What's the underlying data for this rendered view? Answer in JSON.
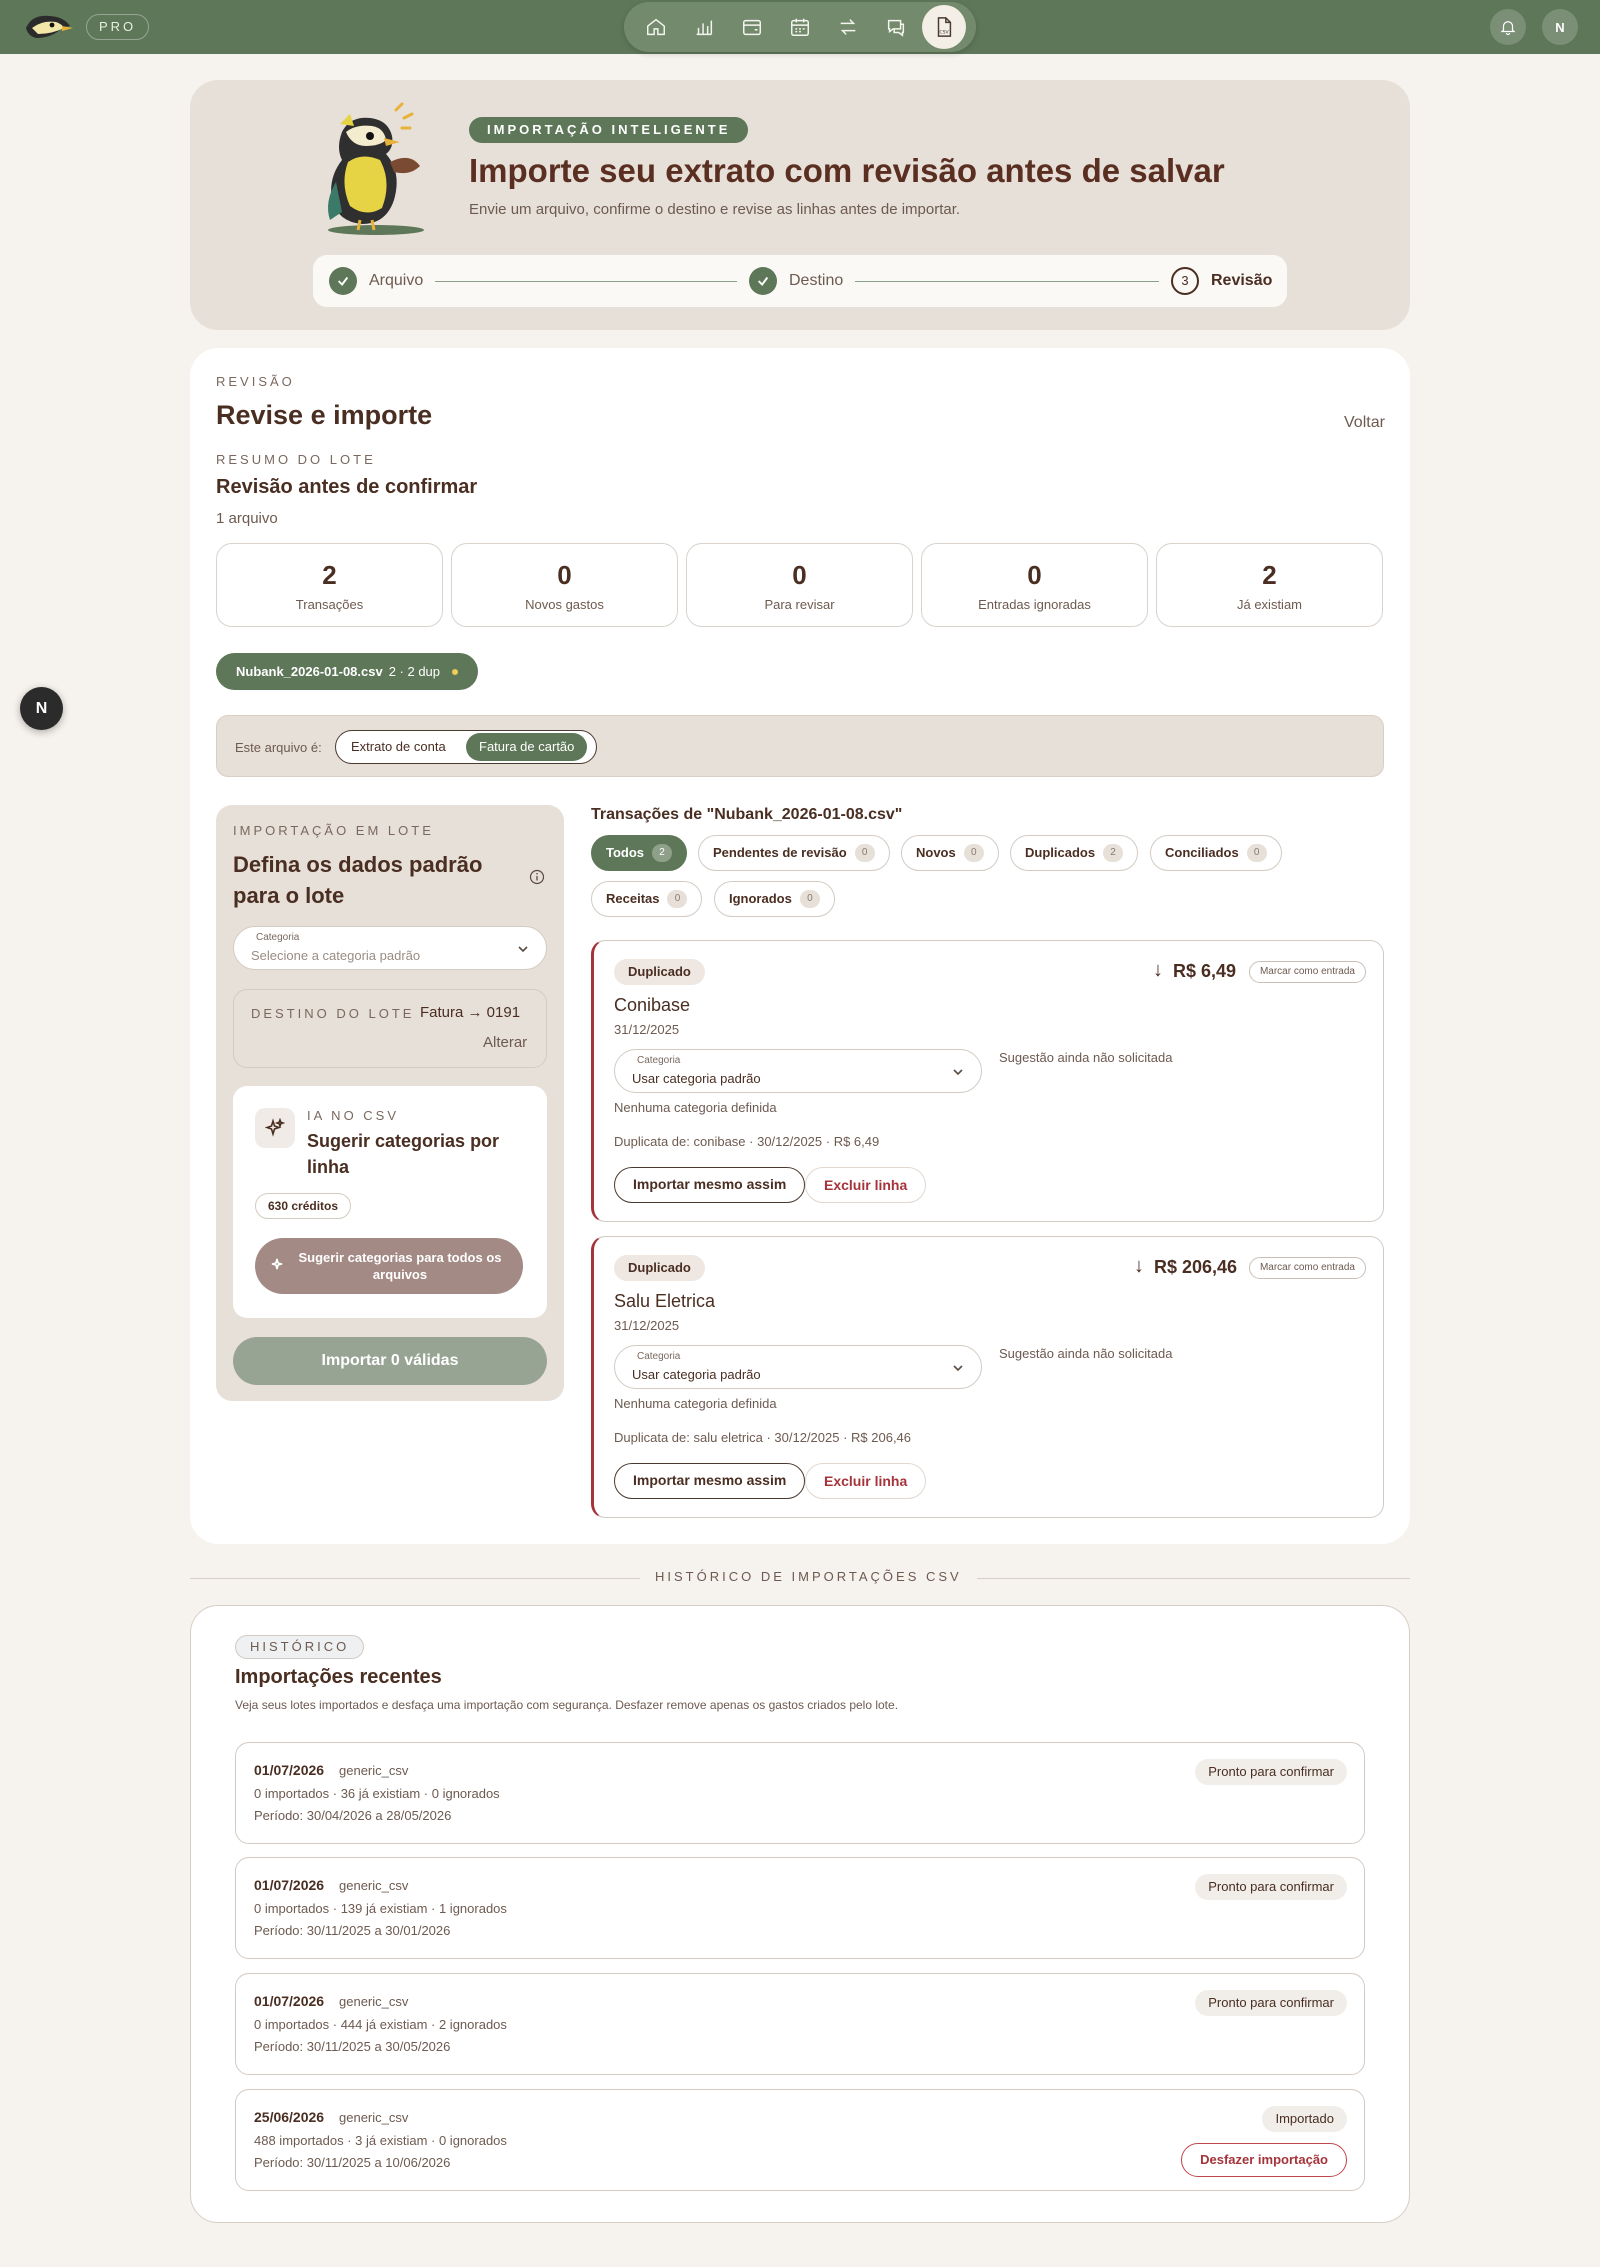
{
  "topbar": {
    "plan_badge": "PRO",
    "notification_icon": "bell-icon",
    "user_initial": "N",
    "nav": [
      {
        "id": "home",
        "icon": "home-icon"
      },
      {
        "id": "reports",
        "icon": "bar-chart-icon"
      },
      {
        "id": "wallet",
        "icon": "wallet-icon"
      },
      {
        "id": "calendar",
        "icon": "calendar-icon"
      },
      {
        "id": "transfers",
        "icon": "swap-icon"
      },
      {
        "id": "chat",
        "icon": "chat-icon"
      },
      {
        "id": "csv",
        "icon": "csv-file-icon",
        "glyph": "CSV",
        "active": true
      }
    ]
  },
  "hero": {
    "tag": "IMPORTAÇÃO INTELIGENTE",
    "title": "Importe seu extrato com revisão antes de salvar",
    "subtitle": "Envie um arquivo, confirme o destino e revise as linhas antes de importar.",
    "steps": [
      {
        "label": "Arquivo",
        "state": "done"
      },
      {
        "label": "Destino",
        "state": "done"
      },
      {
        "label": "Revisão",
        "state": "current",
        "number": "3"
      }
    ]
  },
  "review": {
    "eyebrow": "REVISÃO",
    "title": "Revise e importe",
    "back_label": "Voltar",
    "summary_eyebrow": "RESUMO DO LOTE",
    "summary_title": "Revisão antes de confirmar",
    "file_count": "1 arquivo",
    "stats": [
      {
        "value": "2",
        "label": "Transações"
      },
      {
        "value": "0",
        "label": "Novos gastos"
      },
      {
        "value": "0",
        "label": "Para revisar"
      },
      {
        "value": "0",
        "label": "Entradas ignoradas"
      },
      {
        "value": "2",
        "label": "Já existiam"
      }
    ],
    "file_chip": {
      "name": "Nubank_2026-01-08.csv",
      "meta": "2 · 2 dup"
    },
    "file_type": {
      "label": "Este arquivo é:",
      "options": [
        "Extrato de conta",
        "Fatura de cartão"
      ],
      "selected": "Fatura de cartão"
    }
  },
  "batch": {
    "eyebrow": "IMPORTAÇÃO EM LOTE",
    "title": "Defina os dados padrão para o lote",
    "category_caption": "Categoria",
    "category_placeholder": "Selecione a categoria padrão",
    "destination_eyebrow": "DESTINO DO LOTE",
    "destination_value": "Fatura → 0191",
    "change_label": "Alterar",
    "ai": {
      "eyebrow": "IA NO CSV",
      "title": "Sugerir categorias por linha",
      "credits": "630 créditos",
      "button_label": "Sugerir categorias para todos os arquivos"
    },
    "import_button": "Importar 0 válidas"
  },
  "transactions": {
    "title": "Transações de \"Nubank_2026-01-08.csv\"",
    "filters": [
      {
        "label": "Todos",
        "count": "2",
        "active": true
      },
      {
        "label": "Pendentes de revisão",
        "count": "0"
      },
      {
        "label": "Novos",
        "count": "0"
      },
      {
        "label": "Duplicados",
        "count": "2"
      },
      {
        "label": "Conciliados",
        "count": "0"
      },
      {
        "label": "Receitas",
        "count": "0"
      },
      {
        "label": "Ignorados",
        "count": "0"
      }
    ],
    "items": [
      {
        "badge": "Duplicado",
        "amount": "R$ 6,49",
        "direction": "↓",
        "mark_label": "Marcar como entrada",
        "name": "Conibase",
        "date": "31/12/2025",
        "category_caption": "Categoria",
        "category_value": "Usar categoria padrão",
        "suggestion": "Sugestão ainda não solicitada",
        "no_category": "Nenhuma categoria definida",
        "duplicate_of": "Duplicata de: conibase · 30/12/2025 · R$ 6,49",
        "import_anyway": "Importar mesmo assim",
        "delete_line": "Excluir linha"
      },
      {
        "badge": "Duplicado",
        "amount": "R$ 206,46",
        "direction": "↓",
        "mark_label": "Marcar como entrada",
        "name": "Salu Eletrica",
        "date": "31/12/2025",
        "category_caption": "Categoria",
        "category_value": "Usar categoria padrão",
        "suggestion": "Sugestão ainda não solicitada",
        "no_category": "Nenhuma categoria definida",
        "duplicate_of": "Duplicata de: salu eletrica · 30/12/2025 · R$ 206,46",
        "import_anyway": "Importar mesmo assim",
        "delete_line": "Excluir linha"
      }
    ]
  },
  "history": {
    "divider_label": "HISTÓRICO DE IMPORTAÇÕES CSV",
    "tag": "HISTÓRICO",
    "title": "Importações recentes",
    "subtitle": "Veja seus lotes importados e desfaça uma importação com segurança. Desfazer remove apenas os gastos criados pelo lote.",
    "rows": [
      {
        "date": "01/07/2026",
        "source": "generic_csv",
        "stats": "0 importados · 36 já existiam · 0 ignorados",
        "period": "Período: 30/04/2026 a 28/05/2026",
        "status": "Pronto para confirmar"
      },
      {
        "date": "01/07/2026",
        "source": "generic_csv",
        "stats": "0 importados · 139 já existiam · 1 ignorados",
        "period": "Período: 30/11/2025 a 30/01/2026",
        "status": "Pronto para confirmar"
      },
      {
        "date": "01/07/2026",
        "source": "generic_csv",
        "stats": "0 importados · 444 já existiam · 2 ignorados",
        "period": "Período: 30/11/2025 a 30/05/2026",
        "status": "Pronto para confirmar"
      },
      {
        "date": "25/06/2026",
        "source": "generic_csv",
        "stats": "488 importados · 3 já existiam · 0 ignorados",
        "period": "Período: 30/11/2025 a 10/06/2026",
        "status": "Importado",
        "undo_label": "Desfazer importação"
      }
    ]
  },
  "floating_button": "N"
}
